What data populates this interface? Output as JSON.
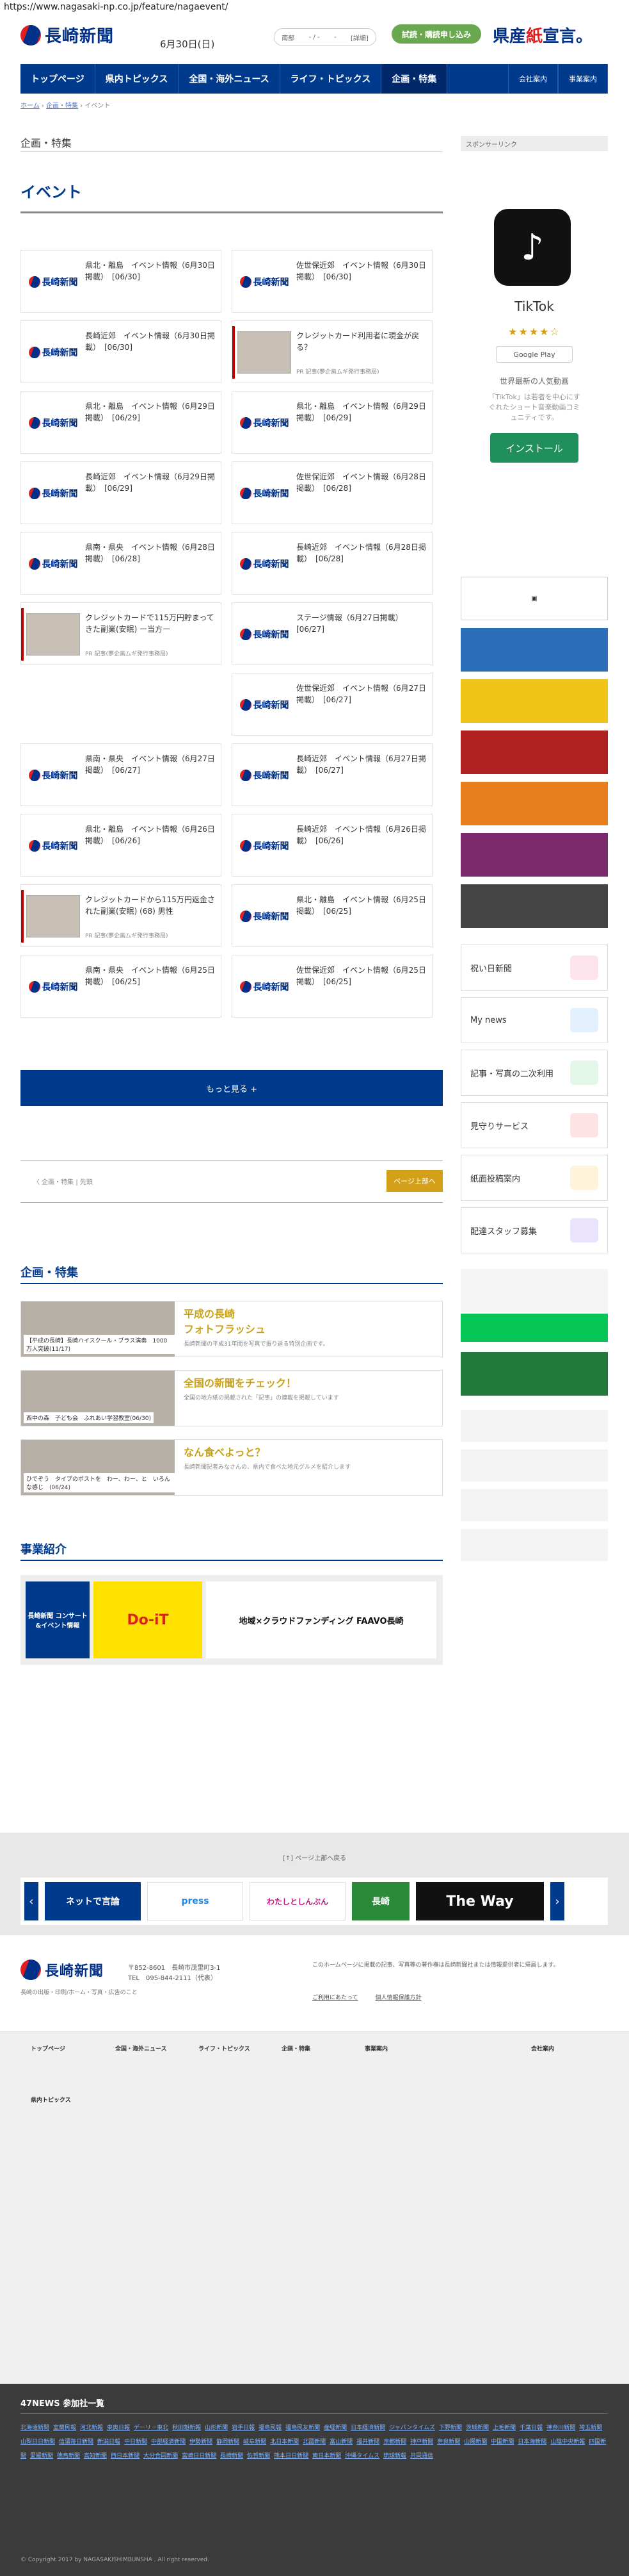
{
  "url": "https://www.nagasaki-np.co.jp/feature/nagaevent/",
  "header": {
    "logo": "長崎新聞",
    "date": "6月30日(日)",
    "weather": [
      "南部",
      "- / -",
      "-",
      "[詳細]"
    ],
    "trial_button": "試読・購読申し込み",
    "ad_text_left": "県産",
    "ad_text_mid": "紙",
    "ad_text_right": "宣言。"
  },
  "nav": {
    "items": [
      "トップページ",
      "県内トピックス",
      "全国・海外ニュース",
      "ライフ・トピックス",
      "企画・特集"
    ],
    "right": [
      "会社案内",
      "事業案内"
    ]
  },
  "breadcrumb": [
    "ホーム",
    "企画・特集",
    "イベント"
  ],
  "category": "企画・特集",
  "page_title": "イベント",
  "cards": [
    {
      "text": "県北・離島　イベント情報（6月30日掲載）　[06/30]",
      "type": "logo"
    },
    {
      "text": "佐世保近郊　イベント情報（6月30日掲載）　[06/30]",
      "type": "logo"
    },
    {
      "text": "長崎近郊　イベント情報（6月30日掲載）　[06/30]",
      "type": "logo"
    },
    {
      "text": "クレジットカード利用者に現金が戻る？",
      "type": "photo",
      "src": "PR 記事(夢企画ムギ発行事務局)"
    },
    {
      "text": "県北・離島　イベント情報（6月29日掲載）　[06/29]",
      "type": "logo"
    },
    {
      "text": "県北・離島　イベント情報（6月29日掲載）　[06/29]",
      "type": "logo"
    },
    {
      "text": "長崎近郊　イベント情報（6月29日掲載）　[06/29]",
      "type": "logo"
    },
    {
      "text": "佐世保近郊　イベント情報（6月28日掲載）　[06/28]",
      "type": "logo"
    },
    {
      "text": "県南・県央　イベント情報（6月28日掲載）　[06/28]",
      "type": "logo"
    },
    {
      "text": "長崎近郊　イベント情報（6月28日掲載）　[06/28]",
      "type": "logo"
    },
    {
      "text": "クレジットカードで115万円貯まってきた副業(安眠) ー当方ー",
      "type": "photo",
      "src": "PR 記事(夢企画ムギ発行事務局)"
    },
    {
      "text": "ステージ情報（6月27日掲載）　[06/27]",
      "type": "logo"
    },
    {
      "text": "",
      "type": "none"
    },
    {
      "text": "佐世保近郊　イベント情報（6月27日掲載）　[06/27]",
      "type": "logo"
    },
    {
      "text": "県南・県央　イベント情報（6月27日掲載）　[06/27]",
      "type": "logo"
    },
    {
      "text": "長崎近郊　イベント情報（6月27日掲載）　[06/27]",
      "type": "logo"
    },
    {
      "text": "県北・離島　イベント情報（6月26日掲載）　[06/26]",
      "type": "logo"
    },
    {
      "text": "長崎近郊　イベント情報（6月26日掲載）　[06/26]",
      "type": "logo"
    },
    {
      "text": "クレジットカードから115万円返金された副業(安眠) (68) 男性",
      "type": "photo",
      "src": "PR 記事(夢企画ムギ発行事務局)"
    },
    {
      "text": "県北・離島　イベント情報（6月25日掲載）　[06/25]",
      "type": "logo"
    },
    {
      "text": "県南・県央　イベント情報（6月25日掲載）　[06/25]",
      "type": "logo"
    },
    {
      "text": "佐世保近郊　イベント情報（6月25日掲載）　[06/25]",
      "type": "logo"
    }
  ],
  "more_button": "もっと見る +",
  "pager": {
    "left": "〈 企画・特集 | 先頭",
    "top_button": "ページ上部へ"
  },
  "features_title": "企画・特集",
  "features": [
    {
      "caption": "【平成の長崎】長崎ハイスクール・ブラス演奏　1000万人突破(11/17)",
      "title": "平成の長崎\nフォトフラッシュ",
      "desc": "長崎新聞の平成31年間を写真で振り返る特別企画です。"
    },
    {
      "caption": "西中の森　子ども会　ふれあい学習教室(06/30)",
      "title": "全国の新聞をチェック！",
      "desc": "全国の地方紙の掲載された「記事」の連載を掲載しています"
    },
    {
      "caption": "ひでぞう　タイプのポストを　わー、わー、と　いろんな感じ　(06/24)",
      "title": "なん食べよっと？",
      "desc": "長崎新聞記者みなさんの、県内で食べた地元グルメを紹介します"
    }
  ],
  "business_title": "事業紹介",
  "business": [
    "長崎新聞 コンサート&イベント情報",
    "Do-iT",
    "地域×クラウドファンディング FAAVO長崎"
  ],
  "sidebar": {
    "sponsor": "スポンサーリンク",
    "tiktok": {
      "name": "TikTok",
      "stars": "★★★★☆",
      "store": "Google Play",
      "desc1": "世界最新の人気動画",
      "desc2": "「TikTok」は若者を中心にすぐれたショート音楽動画コミュニティです。",
      "button": "インストール"
    },
    "pills": [
      "祝い日新聞",
      "My news",
      "記事・写真の二次利用",
      "見守りサービス",
      "紙面投稿案内",
      "配達スタッフ募集"
    ]
  },
  "bottom": {
    "top_link": "[↑] ページ上部へ戻る",
    "partners": [
      "ネットで言論",
      "press",
      "わたしとしんぶん",
      "長崎",
      "The Way"
    ]
  },
  "footer": {
    "address": "〒852-8601　長崎市茂里町3-1",
    "tel": "TEL　095-844-2111（代表）",
    "sub": "長崎の出版・印刷/ホーム・写真・広告のこと",
    "note": "このホームページに掲載の記事、写真等の著作権は長崎新聞社または情報提供者に帰属します。",
    "links": [
      "ご利用にあたって",
      "個人情報保護方針"
    ]
  },
  "network": {
    "title": "47NEWS 参加社一覧",
    "papers": [
      "北海道新聞",
      "室蘭民報",
      "河北新報",
      "東奥日報",
      "デーリー東北",
      "秋田魁新報",
      "山形新聞",
      "岩手日報",
      "福島民報",
      "福島民友新聞",
      "産経新聞",
      "日本経済新聞",
      "ジャパンタイムズ",
      "下野新聞",
      "茨城新聞",
      "上毛新聞",
      "千葉日報",
      "神奈川新聞",
      "埼玉新聞",
      "山梨日日新聞",
      "信濃毎日新聞",
      "新潟日報",
      "中日新聞",
      "中部経済新聞",
      "伊勢新聞",
      "静岡新聞",
      "岐阜新聞",
      "北日本新聞",
      "北國新聞",
      "富山新聞",
      "福井新聞",
      "京都新聞",
      "神戸新聞",
      "奈良新聞",
      "山陽新聞",
      "中国新聞",
      "日本海新聞",
      "山陰中央新報",
      "四国新聞",
      "愛媛新聞",
      "徳島新聞",
      "高知新聞",
      "西日本新聞",
      "大分合同新聞",
      "宮崎日日新聞",
      "長崎新聞",
      "佐賀新聞",
      "熊本日日新聞",
      "南日本新聞",
      "沖縄タイムス",
      "琉球新報",
      "共同通信"
    ]
  },
  "copyright": "© Copyright 2017 by NAGASAKISHIMBUNSHA . All right reserved."
}
